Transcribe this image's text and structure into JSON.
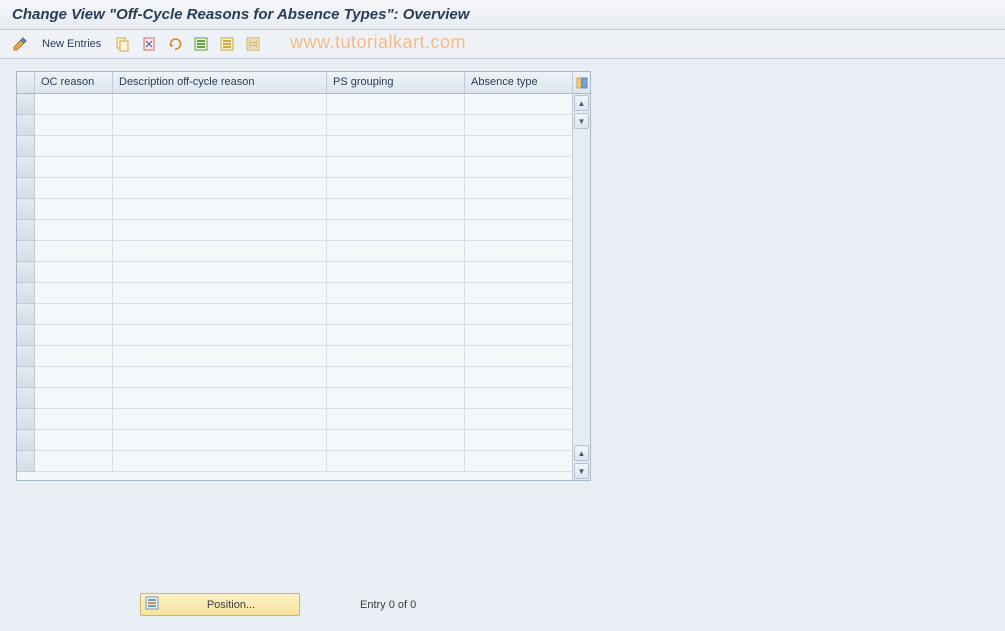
{
  "title": "Change View \"Off-Cycle Reasons for Absence Types\": Overview",
  "toolbar": {
    "new_entries_label": "New Entries"
  },
  "watermark": "www.tutorialkart.com",
  "table": {
    "columns": {
      "oc_reason": "OC reason",
      "description": "Description off-cycle reason",
      "ps_grouping": "PS grouping",
      "absence_type": "Absence type"
    },
    "row_count": 18
  },
  "footer": {
    "position_label": "Position...",
    "entry_text": "Entry 0 of 0"
  }
}
